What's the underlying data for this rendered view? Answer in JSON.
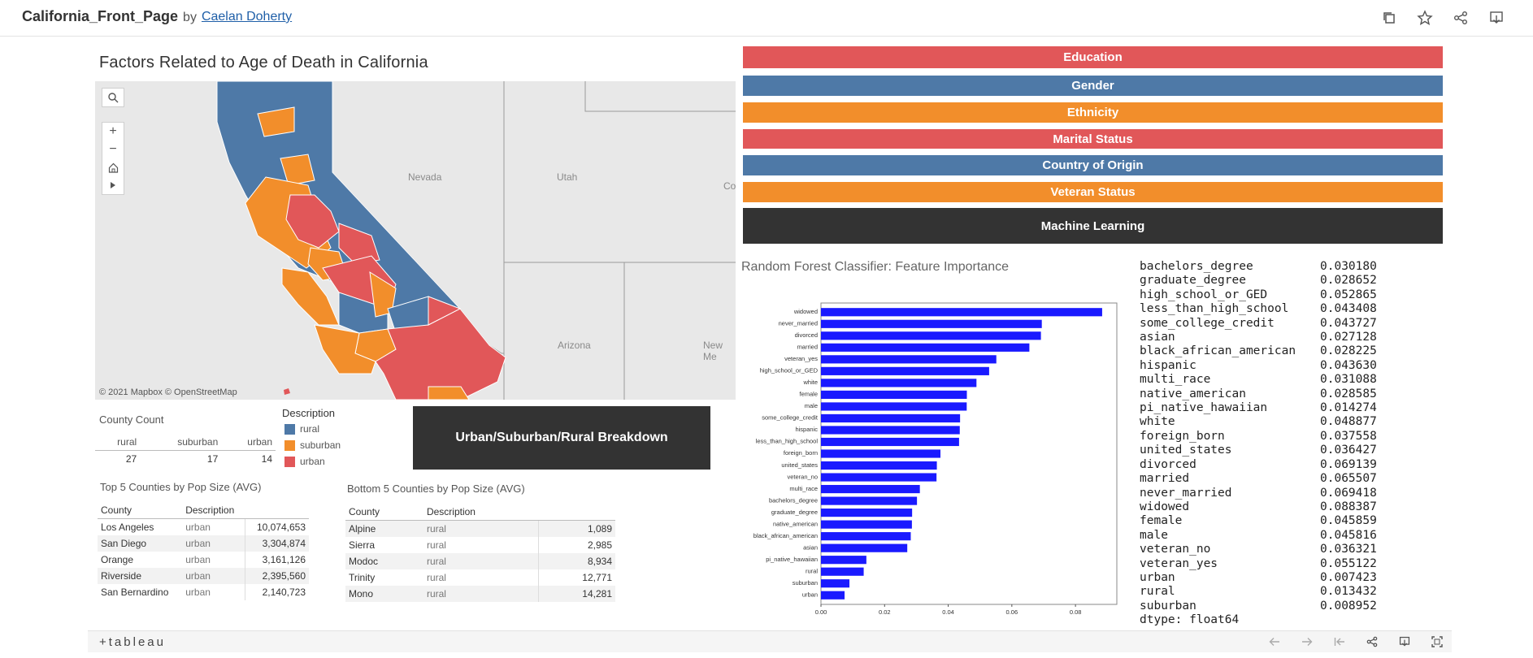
{
  "header": {
    "title": "California_Front_Page",
    "by": "by",
    "author": "Caelan Doherty",
    "icons": [
      "duplicate-icon",
      "star-icon",
      "share-icon",
      "download-icon"
    ]
  },
  "dashboard": {
    "title": "Factors Related to Age of Death in California"
  },
  "map": {
    "labels": {
      "nevada": "Nevada",
      "utah": "Utah",
      "arizona": "Arizona",
      "new_mexico": "New Me",
      "colorado": "Co"
    },
    "attribution": "© 2021 Mapbox  © OpenStreetMap",
    "controls": [
      "search-icon",
      "zoom-in-icon",
      "zoom-out-icon",
      "home-icon",
      "play-icon"
    ],
    "colors": {
      "rural": "#4e79a7",
      "suburban": "#f28e2b",
      "urban": "#e15759"
    }
  },
  "nav_buttons": [
    {
      "label": "Education",
      "color": "#e15759"
    },
    {
      "label": "Gender",
      "color": "#4e79a7"
    },
    {
      "label": "Ethnicity",
      "color": "#f28e2b"
    },
    {
      "label": "Marital Status",
      "color": "#e15759"
    },
    {
      "label": "Country of Origin",
      "color": "#4e79a7"
    },
    {
      "label": "Veteran Status",
      "color": "#f28e2b"
    },
    {
      "label": "Machine Learning",
      "color": "#333333"
    }
  ],
  "county_count": {
    "caption": "County Count",
    "headers": [
      "rural",
      "suburban",
      "urban"
    ],
    "values": [
      "27",
      "17",
      "14"
    ]
  },
  "legend": {
    "title": "Description",
    "items": [
      {
        "label": "rural",
        "color": "#4e79a7"
      },
      {
        "label": "suburban",
        "color": "#f28e2b"
      },
      {
        "label": "urban",
        "color": "#e15759"
      }
    ]
  },
  "breakdown_button": "Urban/Suburban/Rural Breakdown",
  "top5": {
    "caption": "Top 5 Counties by Pop Size (AVG)",
    "headers": [
      "County",
      "Description"
    ],
    "rows": [
      [
        "Los Angeles",
        "urban",
        "10,074,653"
      ],
      [
        "San Diego",
        "urban",
        "3,304,874"
      ],
      [
        "Orange",
        "urban",
        "3,161,126"
      ],
      [
        "Riverside",
        "urban",
        "2,395,560"
      ],
      [
        "San Bernardino",
        "urban",
        "2,140,723"
      ]
    ]
  },
  "bottom5": {
    "caption": "Bottom 5 Counties by Pop Size (AVG)",
    "headers": [
      "County",
      "Description"
    ],
    "rows": [
      [
        "Alpine",
        "rural",
        "1,089"
      ],
      [
        "Sierra",
        "rural",
        "2,985"
      ],
      [
        "Modoc",
        "rural",
        "8,934"
      ],
      [
        "Trinity",
        "rural",
        "12,771"
      ],
      [
        "Mono",
        "rural",
        "14,281"
      ]
    ]
  },
  "rf_title": "Random Forest Classifier: Feature Importance",
  "chart_data": {
    "type": "bar",
    "orientation": "horizontal",
    "categories": [
      "widowed",
      "never_married",
      "divorced",
      "married",
      "veteran_yes",
      "high_school_or_GED",
      "white",
      "female",
      "male",
      "some_college_credit",
      "hispanic",
      "less_than_high_school",
      "foreign_born",
      "united_states",
      "veteran_no",
      "multi_race",
      "bachelors_degree",
      "graduate_degree",
      "native_american",
      "black_african_american",
      "asian",
      "pi_native_hawaiian",
      "rural",
      "suburban",
      "urban"
    ],
    "values": [
      0.088387,
      0.069418,
      0.069139,
      0.065507,
      0.055122,
      0.052865,
      0.048877,
      0.045859,
      0.045816,
      0.043727,
      0.04363,
      0.043408,
      0.037558,
      0.036427,
      0.036321,
      0.031088,
      0.03018,
      0.028652,
      0.028585,
      0.028225,
      0.027128,
      0.014274,
      0.013432,
      0.008952,
      0.007423
    ],
    "xticks": [
      "0.00",
      "0.02",
      "0.04",
      "0.06",
      "0.08"
    ],
    "xlim": [
      0,
      0.093
    ],
    "bar_color": "#1a1aff"
  },
  "dtype_table": {
    "rows": [
      [
        "bachelors_degree",
        "0.030180"
      ],
      [
        "graduate_degree",
        "0.028652"
      ],
      [
        "high_school_or_GED",
        "0.052865"
      ],
      [
        "less_than_high_school",
        "0.043408"
      ],
      [
        "some_college_credit",
        "0.043727"
      ],
      [
        "asian",
        "0.027128"
      ],
      [
        "black_african_american",
        "0.028225"
      ],
      [
        "hispanic",
        "0.043630"
      ],
      [
        "multi_race",
        "0.031088"
      ],
      [
        "native_american",
        "0.028585"
      ],
      [
        "pi_native_hawaiian",
        "0.014274"
      ],
      [
        "white",
        "0.048877"
      ],
      [
        "foreign_born",
        "0.037558"
      ],
      [
        "united_states",
        "0.036427"
      ],
      [
        "divorced",
        "0.069139"
      ],
      [
        "married",
        "0.065507"
      ],
      [
        "never_married",
        "0.069418"
      ],
      [
        "widowed",
        "0.088387"
      ],
      [
        "female",
        "0.045859"
      ],
      [
        "male",
        "0.045816"
      ],
      [
        "veteran_no",
        "0.036321"
      ],
      [
        "veteran_yes",
        "0.055122"
      ],
      [
        "urban",
        "0.007423"
      ],
      [
        "rural",
        "0.013432"
      ],
      [
        "suburban",
        "0.008952"
      ]
    ],
    "footer": "dtype: float64"
  },
  "footer": {
    "logo": "+tableau",
    "icons": [
      "back-icon",
      "forward-icon",
      "revert-icon",
      "share-icon",
      "download-icon",
      "fullscreen-icon"
    ]
  }
}
